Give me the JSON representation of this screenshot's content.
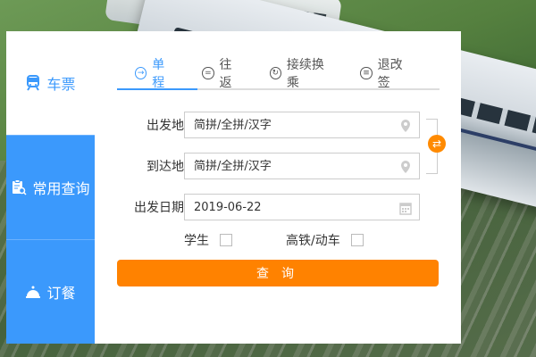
{
  "side": {
    "items": [
      {
        "label": "车票",
        "icon": "train-icon",
        "active": true
      },
      {
        "label": "常用查询",
        "icon": "clipboard-search-icon",
        "active": false
      },
      {
        "label": "订餐",
        "icon": "food-cloche-icon",
        "active": false
      }
    ]
  },
  "tabs": [
    {
      "label": "单程",
      "icon": "arrow-right-circle-icon",
      "active": true
    },
    {
      "label": "往返",
      "icon": "equals-circle-icon",
      "active": false
    },
    {
      "label": "接续换乘",
      "icon": "refresh-circle-icon",
      "active": false
    },
    {
      "label": "退改签",
      "icon": "exchange-circle-icon",
      "active": false
    }
  ],
  "form": {
    "from_label": "出发地",
    "from_placeholder": "简拼/全拼/汉字",
    "to_label": "到达地",
    "to_placeholder": "简拼/全拼/汉字",
    "date_label": "出发日期",
    "date_value": "2019-06-22",
    "student_label": "学生",
    "highspeed_label": "高铁/动车",
    "search_label": "查询"
  },
  "colors": {
    "accent_blue": "#3b99fc",
    "accent_orange": "#ff8200"
  }
}
